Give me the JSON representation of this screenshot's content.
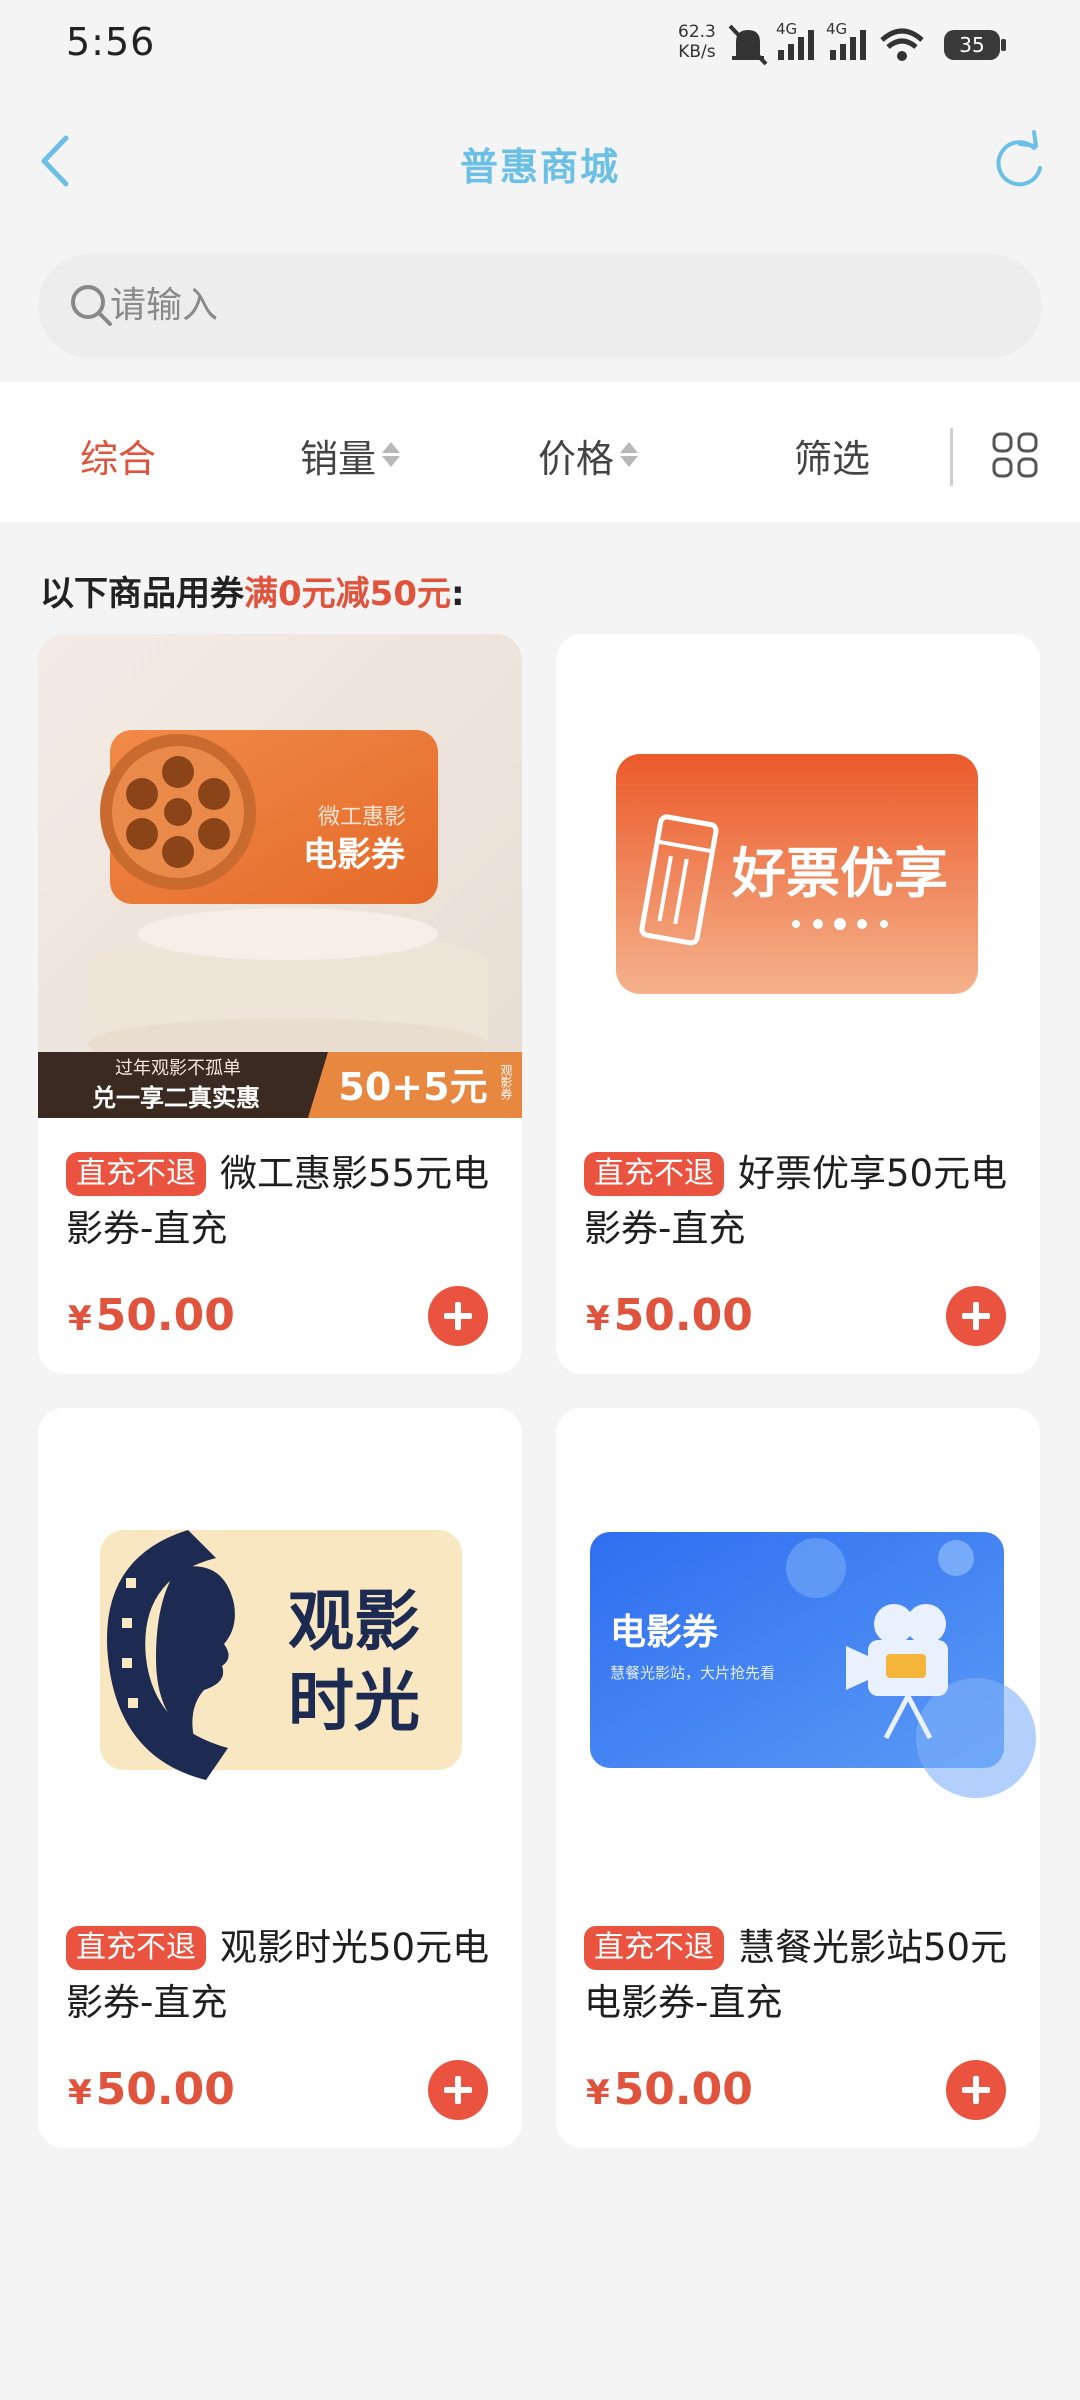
{
  "status": {
    "time": "5:56",
    "net_speed_value": "62.3",
    "net_speed_unit": "KB/s",
    "sim1": "4G",
    "sim2": "4G",
    "battery": "35"
  },
  "header": {
    "title": "普惠商城"
  },
  "search": {
    "placeholder": "请输入"
  },
  "sort_tabs": [
    {
      "label": "综合",
      "active": true
    },
    {
      "label": "销量",
      "active": false
    },
    {
      "label": "价格",
      "active": false
    },
    {
      "label": "筛选",
      "active": false
    }
  ],
  "coupon_note": {
    "prefix": "以下商品用券",
    "highlight": "满0元减50元",
    "suffix": ":"
  },
  "products": [
    {
      "tag": "直充不退",
      "title": "微工惠影55元电影券-直充",
      "price": "50.00",
      "currency": "¥",
      "image": {
        "brand": "微工惠影",
        "label": "电影券",
        "banner_top": "过年观影不孤单",
        "banner_bottom": "兑一享二真实惠",
        "banner_price": "50+5元",
        "banner_side": "观影券"
      }
    },
    {
      "tag": "直充不退",
      "title": "好票优享50元电影券-直充",
      "price": "50.00",
      "currency": "¥",
      "image": {
        "label": "好票优享"
      }
    },
    {
      "tag": "直充不退",
      "title": "观影时光50元电影券-直充",
      "price": "50.00",
      "currency": "¥",
      "image": {
        "line1": "观影",
        "line2": "时光"
      }
    },
    {
      "tag": "直充不退",
      "title": "慧餐光影站50元电影券-直充",
      "price": "50.00",
      "currency": "¥",
      "image": {
        "label": "电影券",
        "sub": "慧餐光影站，大片抢先看"
      }
    }
  ],
  "colors": {
    "accent": "#e0533d",
    "title_blue": "#6cc0e6",
    "background": "#f4f4f4"
  }
}
